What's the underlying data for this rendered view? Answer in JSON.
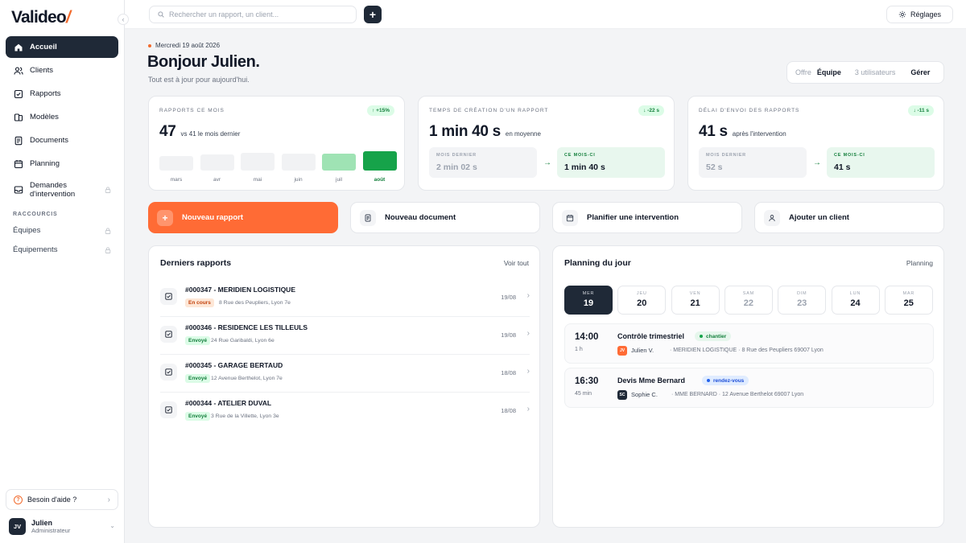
{
  "app": {
    "logo_text": "Valideo",
    "collapse_icon": "chevron-left-icon"
  },
  "colors": {
    "accent": "#ff6b35",
    "dark": "#1f2937",
    "green": "#16a34a",
    "green_light": "#9fe3b4",
    "bar_empty": "#f1f2f4"
  },
  "sidebar": {
    "items": [
      {
        "label": "Accueil",
        "icon": "home-icon"
      },
      {
        "label": "Clients",
        "icon": "users-icon"
      },
      {
        "label": "Rapports",
        "icon": "check-square-icon"
      },
      {
        "label": "Modèles",
        "icon": "templates-icon"
      },
      {
        "label": "Documents",
        "icon": "document-icon"
      },
      {
        "label": "Planning",
        "icon": "calendar-icon"
      },
      {
        "label": "Demandes d'intervention",
        "icon": "inbox-icon"
      }
    ],
    "shortcuts_label": "RACCOURCIS",
    "shortcuts": [
      {
        "label": "Équipes"
      },
      {
        "label": "Équipements"
      }
    ],
    "help_label": "Besoin d'aide ?",
    "user": {
      "initials": "JV",
      "name": "Julien",
      "role": "Administrateur"
    }
  },
  "topbar": {
    "search_placeholder": "Rechercher un rapport, un client...",
    "settings_label": "Réglages"
  },
  "header": {
    "date": "Mercredi 19 août 2026",
    "greeting": "Bonjour Julien.",
    "subtitle": "Tout est à jour pour aujourd'hui.",
    "offer_label": "Offre",
    "offer_value": "Équipe",
    "users_count": "3 utilisateurs",
    "manage_label": "Gérer"
  },
  "kpis": {
    "reports": {
      "title": "RAPPORTS CE MOIS",
      "trend": "↑ +15%",
      "value": "47",
      "compare": "vs 41 le mois dernier"
    },
    "creation_time": {
      "title": "TEMPS DE CRÉATION D'UN RAPPORT",
      "trend": "↓ -22 s",
      "value": "1 min 40 s",
      "suffix": "en moyenne",
      "prev_label": "MOIS DERNIER",
      "prev_value": "2 min 02 s",
      "cur_label": "CE MOIS-CI",
      "cur_value": "1 min 40 s"
    },
    "send_delay": {
      "title": "DÉLAI D'ENVOI DES RAPPORTS",
      "trend": "↓ -11 s",
      "value": "41 s",
      "suffix": "après l'intervention",
      "prev_label": "MOIS DERNIER",
      "prev_value": "52 s",
      "cur_label": "CE MOIS-CI",
      "cur_value": "41 s"
    }
  },
  "chart_data": {
    "type": "bar",
    "categories": [
      "mars",
      "avr",
      "mai",
      "juin",
      "juil",
      "août"
    ],
    "relative_heights": [
      0.8,
      0.9,
      1.0,
      0.95,
      0.96,
      1.1
    ],
    "highlight": "août"
  },
  "actions": [
    {
      "label": "Nouveau rapport",
      "icon": "plus-icon"
    },
    {
      "label": "Nouveau document",
      "icon": "document-icon"
    },
    {
      "label": "Planifier une intervention",
      "icon": "calendar-icon"
    },
    {
      "label": "Ajouter un client",
      "icon": "user-icon"
    }
  ],
  "reports_panel": {
    "title": "Derniers rapports",
    "link": "Voir tout",
    "rows": [
      {
        "title": "#000347 - MERIDIEN LOGISTIQUE",
        "status": "En cours",
        "status_type": "enc",
        "address": "8 Rue des Peupliers, Lyon 7e",
        "date": "19/08"
      },
      {
        "title": "#000346 - RESIDENCE LES TILLEULS",
        "status": "Envoyé",
        "status_type": "env",
        "address": "24 Rue Garibaldi, Lyon 6e",
        "date": "19/08"
      },
      {
        "title": "#000345 - GARAGE BERTAUD",
        "status": "Envoyé",
        "status_type": "env",
        "address": "12 Avenue Berthelot, Lyon 7e",
        "date": "18/08"
      },
      {
        "title": "#000344 - ATELIER DUVAL",
        "status": "Envoyé",
        "status_type": "env",
        "address": "3 Rue de la Villette, Lyon 3e",
        "date": "18/08"
      }
    ]
  },
  "planning_panel": {
    "title": "Planning du jour",
    "link": "Planning",
    "days": [
      {
        "name": "MER",
        "num": "19",
        "selected": true
      },
      {
        "name": "JEU",
        "num": "20"
      },
      {
        "name": "VEN",
        "num": "21"
      },
      {
        "name": "SAM",
        "num": "22",
        "weekend": true
      },
      {
        "name": "DIM",
        "num": "23",
        "weekend": true
      },
      {
        "name": "LUN",
        "num": "24"
      },
      {
        "name": "MAR",
        "num": "25"
      }
    ],
    "events": [
      {
        "time": "14:00",
        "duration": "1 h",
        "title": "Contrôle trimestriel",
        "tag": "chantier",
        "tag_type": "g",
        "initials": "JV",
        "avatar_color": "#ff6b35",
        "person": "Julien V.",
        "location": "· MERIDIEN LOGISTIQUE · 8 Rue des Peupliers 69007 Lyon"
      },
      {
        "time": "16:30",
        "duration": "45 min",
        "title": "Devis Mme Bernard",
        "tag": "rendez-vous",
        "tag_type": "b",
        "initials": "SC",
        "avatar_color": "#1f2937",
        "person": "Sophie C.",
        "location": "· MME BERNARD · 12 Avenue Berthelot 69007 Lyon"
      }
    ]
  }
}
